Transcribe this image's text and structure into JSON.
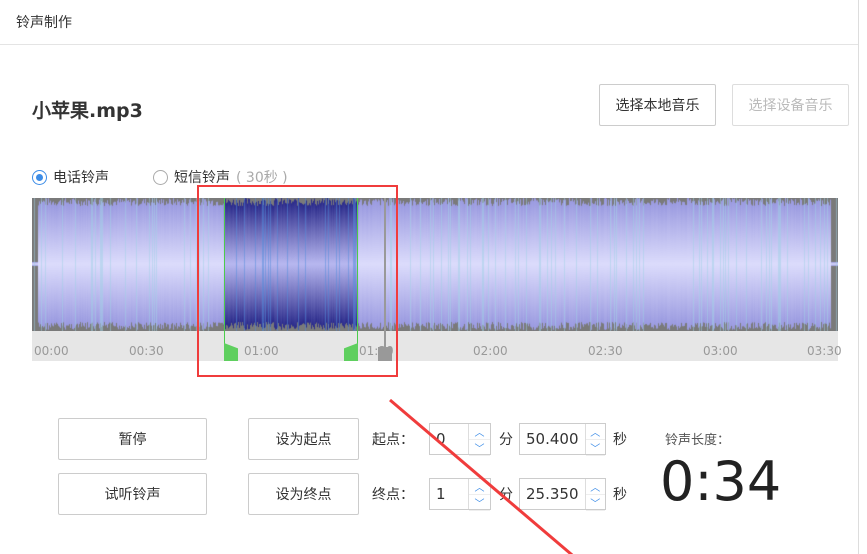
{
  "window": {
    "title": "铃声制作"
  },
  "file": {
    "name": "小苹果.mp3"
  },
  "buttons": {
    "local_music": "选择本地音乐",
    "device_music": "选择设备音乐",
    "pause": "暂停",
    "preview": "试听铃声",
    "set_start": "设为起点",
    "set_end": "设为终点"
  },
  "ringtype": {
    "options": [
      {
        "label": "电话铃声",
        "selected": true
      },
      {
        "label": "短信铃声",
        "hint": "( 30秒 )",
        "selected": false
      }
    ]
  },
  "timeline": {
    "labels": [
      "00:00",
      "00:30",
      "01:00",
      "01:30",
      "02:00",
      "02:30",
      "03:00",
      "03:30"
    ]
  },
  "start": {
    "label": "起点：",
    "min": "0",
    "min_unit": "分",
    "sec": "50.400",
    "sec_unit": "秒"
  },
  "end": {
    "label": "终点：",
    "min": "1",
    "min_unit": "分",
    "sec": "25.350",
    "sec_unit": "秒"
  },
  "length": {
    "label": "铃声长度：",
    "value": "0:34"
  },
  "colors": {
    "accent": "#3c8ce7",
    "selection": "#5fcf5f",
    "annotation": "#f03c3c"
  }
}
